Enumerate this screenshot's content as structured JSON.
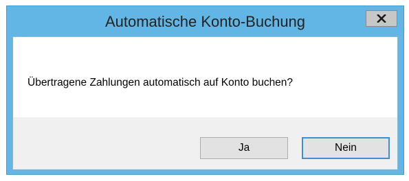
{
  "dialog": {
    "title": "Automatische Konto-Buchung",
    "close_icon": "close-icon",
    "message": "Übertragene Zahlungen automatisch auf Konto buchen?",
    "buttons": {
      "yes_label": "Ja",
      "no_label": "Nein"
    }
  },
  "colors": {
    "title_bar": "#61b6e5",
    "window_border": "#3f9fd6",
    "client_bg": "#ffffff",
    "footer_bg": "#f0f0f0",
    "button_bg": "#e2e2e2",
    "default_button_border": "#3c8fd6"
  }
}
